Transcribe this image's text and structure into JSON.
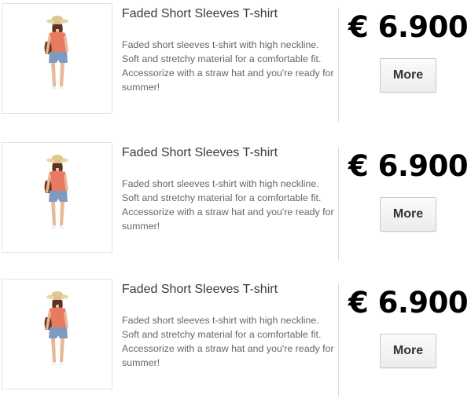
{
  "products": [
    {
      "title": "Faded Short Sleeves T-shirt",
      "description": "Faded short sleeves t-shirt with high neckline. Soft and stretchy material for a comfortable fit. Accessorize with a straw hat and you're ready for summer!",
      "price": "€ 6.900",
      "more_label": "More",
      "image_icon": "product-model-photo"
    },
    {
      "title": "Faded Short Sleeves T-shirt",
      "description": "Faded short sleeves t-shirt with high neckline. Soft and stretchy material for a comfortable fit. Accessorize with a straw hat and you're ready for summer!",
      "price": "€ 6.900",
      "more_label": "More",
      "image_icon": "product-model-photo"
    },
    {
      "title": "Faded Short Sleeves T-shirt",
      "description": "Faded short sleeves t-shirt with high neckline. Soft and stretchy material for a comfortable fit. Accessorize with a straw hat and you're ready for summer!",
      "price": "€ 6.900",
      "more_label": "More",
      "image_icon": "product-model-photo"
    }
  ]
}
